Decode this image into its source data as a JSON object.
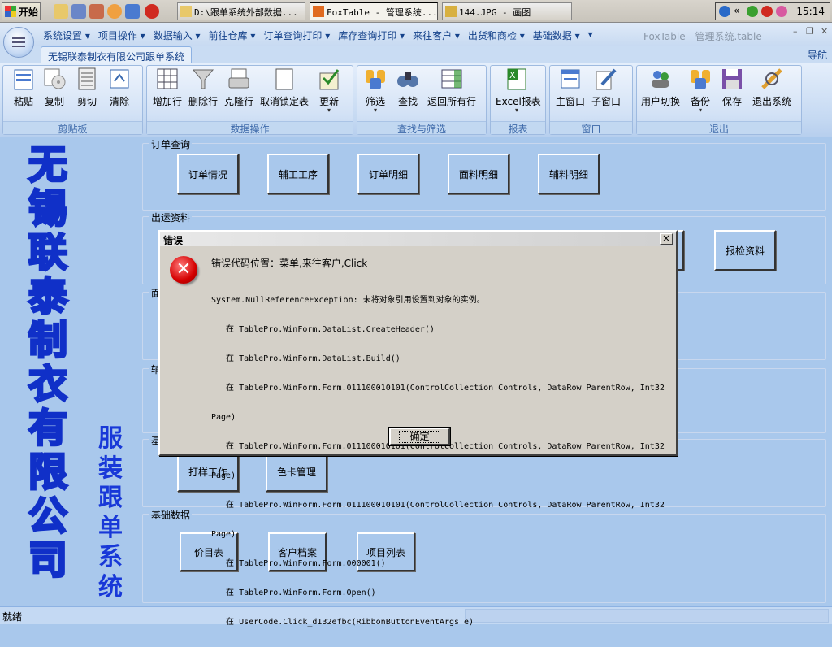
{
  "taskbar": {
    "start_label": "开始",
    "quicklaunch": [
      "folder-icon",
      "save-icon",
      "user-icon",
      "face-icon",
      "arrow-icon",
      "browser-icon"
    ],
    "buttons": [
      {
        "label": "D:\\跟单系统外部数据...",
        "icon": "folder-icon",
        "active": false
      },
      {
        "label": "FoxTable - 管理系统...",
        "icon": "foxtable-icon",
        "active": true
      },
      {
        "label": "144.JPG - 画图",
        "icon": "paint-icon",
        "active": false
      }
    ],
    "tray_chevron": "«",
    "clock": "15:14"
  },
  "app": {
    "title": "FoxTable - 管理系统.table",
    "menu": [
      "系统设置 ▾",
      "项目操作 ▾",
      "数据输入 ▾",
      "前往仓库 ▾",
      "订单查询打印 ▾",
      "库存查询打印 ▾",
      "来往客户 ▾",
      "出货和商检 ▾",
      "基础数据 ▾",
      "▾"
    ],
    "tab": "无锡联泰制衣有限公司跟单系统",
    "nav": "导航"
  },
  "ribbon": {
    "groups": [
      {
        "label": "剪贴板",
        "buttons": [
          {
            "label": "粘贴",
            "icon": "paste-icon"
          },
          {
            "label": "复制",
            "icon": "copy-icon"
          },
          {
            "label": "剪切",
            "icon": "cut-icon"
          },
          {
            "label": "清除",
            "icon": "clear-icon"
          }
        ]
      },
      {
        "label": "数据操作",
        "buttons": [
          {
            "label": "增加行",
            "icon": "add-row-icon"
          },
          {
            "label": "删除行",
            "icon": "delete-row-icon"
          },
          {
            "label": "克隆行",
            "icon": "clone-row-icon"
          },
          {
            "label": "取消锁定表",
            "icon": "unlock-table-icon"
          },
          {
            "label": "更新",
            "icon": "update-icon"
          }
        ]
      },
      {
        "label": "查找与筛选",
        "buttons": [
          {
            "label": "筛选",
            "icon": "filter-icon"
          },
          {
            "label": "查找",
            "icon": "find-icon"
          },
          {
            "label": "返回所有行",
            "icon": "show-all-rows-icon"
          }
        ]
      },
      {
        "label": "报表",
        "buttons": [
          {
            "label": "Excel报表",
            "icon": "excel-icon"
          }
        ]
      },
      {
        "label": "窗口",
        "buttons": [
          {
            "label": "主窗口",
            "icon": "main-window-icon"
          },
          {
            "label": "子窗口",
            "icon": "child-window-icon"
          }
        ]
      },
      {
        "label": "退出",
        "buttons": [
          {
            "label": "用户切换",
            "icon": "switch-user-icon"
          },
          {
            "label": "备份",
            "icon": "backup-icon"
          },
          {
            "label": "保存",
            "icon": "save-icon"
          },
          {
            "label": "退出系统",
            "icon": "exit-icon"
          }
        ]
      }
    ]
  },
  "brand": {
    "company_chars": [
      "无",
      "锡",
      "联",
      "泰",
      "制",
      "衣",
      "有",
      "限",
      "公",
      "司"
    ],
    "system_chars": [
      "服",
      "装",
      "跟",
      "单",
      "系",
      "统"
    ]
  },
  "panels": [
    {
      "label": "订单查询",
      "buttons": [
        "订单情况",
        "辅工工序",
        "订单明细",
        "面料明细",
        "辅料明细"
      ]
    },
    {
      "label": "出运资料",
      "buttons": [
        "报检资料"
      ]
    },
    {
      "label": "面",
      "buttons": []
    },
    {
      "label": "辅",
      "buttons": []
    },
    {
      "label": "基",
      "buttons": [
        "打样工作",
        "色卡管理"
      ]
    },
    {
      "label": "基础数据",
      "buttons": [
        "价目表",
        "客户档案",
        "项目列表"
      ]
    }
  ],
  "status": {
    "text": "就绪"
  },
  "dialog": {
    "title": "错误",
    "close": "×",
    "heading": "错误代码位置：菜单,来往客户,Click",
    "lines": [
      "System.NullReferenceException: 未将对象引用设置到对象的实例。",
      "   在 TablePro.WinForm.DataList.CreateHeader()",
      "   在 TablePro.WinForm.DataList.Build()",
      "   在 TablePro.WinForm.Form.011100010101(ControlCollection Controls, DataRow ParentRow, Int32",
      "Page)",
      "   在 TablePro.WinForm.Form.011100010101(ControlCollection Controls, DataRow ParentRow, Int32",
      "Page)",
      "   在 TablePro.WinForm.Form.011100010101(ControlCollection Controls, DataRow ParentRow, Int32",
      "Page)",
      "   在 TablePro.WinForm.Form.000001()",
      "   在 TablePro.WinForm.Form.Open()",
      "   在 UserCode.Click_d132efbc(RibbonButtonEventArgs e)"
    ],
    "ok": "确定"
  }
}
